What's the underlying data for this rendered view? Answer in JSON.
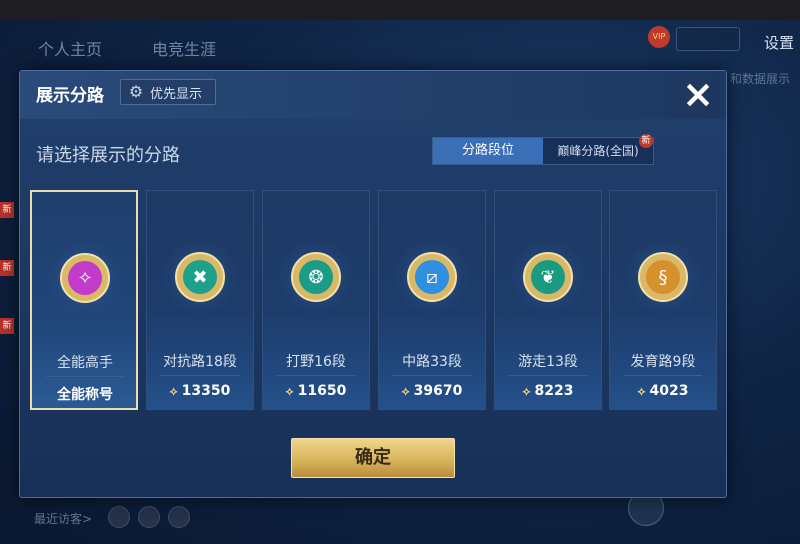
{
  "background": {
    "tabs": [
      "个人主页",
      "电竞生涯"
    ],
    "settings_label": "设置",
    "right_text": "和数据展示",
    "visitors_label": "最近访客>",
    "new_badge": "新"
  },
  "modal": {
    "title": "展示分路",
    "priority_label": "优先显示",
    "close_icon": "×",
    "prompt": "请选择展示的分路",
    "segments": [
      {
        "label": "分路段位",
        "active": true
      },
      {
        "label": "巅峰分路(全国)",
        "active": false,
        "badge": "新"
      }
    ],
    "cards": [
      {
        "name": "全能高手",
        "score": "全能称号",
        "emblem_color": "#c23bc9",
        "emblem_symbol": "✧",
        "selected": true
      },
      {
        "name": "对抗路18段",
        "score": "13350",
        "emblem_color": "#1ea18a",
        "emblem_symbol": "✖",
        "selected": false
      },
      {
        "name": "打野16段",
        "score": "11650",
        "emblem_color": "#1c9c88",
        "emblem_symbol": "❂",
        "selected": false
      },
      {
        "name": "中路33段",
        "score": "39670",
        "emblem_color": "#2f8fe0",
        "emblem_symbol": "⧄",
        "selected": false
      },
      {
        "name": "游走13段",
        "score": "8223",
        "emblem_color": "#1a9a80",
        "emblem_symbol": "❦",
        "selected": false
      },
      {
        "name": "发育路9段",
        "score": "4023",
        "emblem_color": "#d6902c",
        "emblem_symbol": "§",
        "selected": false
      }
    ],
    "score_icon": "⟡",
    "confirm_label": "确定"
  },
  "colors": {
    "accent_blue": "#3a6fb7",
    "gold": "#d8b45e",
    "selected_border": "#e9dcb0"
  }
}
